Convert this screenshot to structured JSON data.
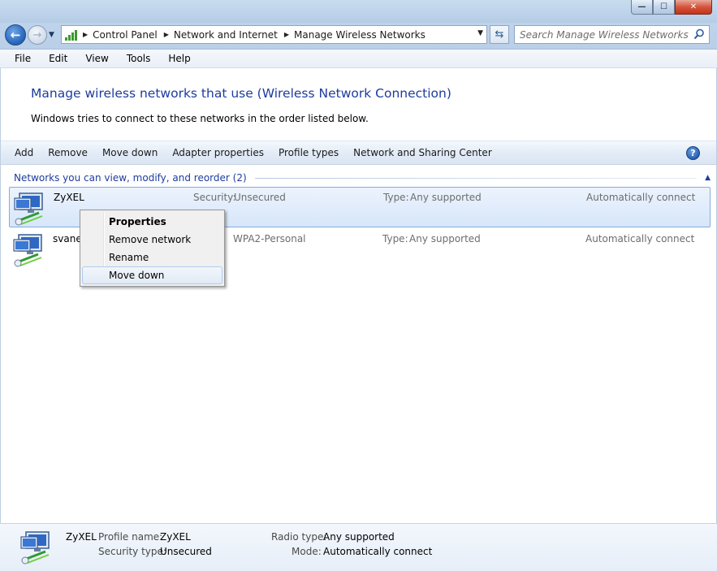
{
  "window": {
    "minimize_label": "—",
    "maximize_label": "☐",
    "close_label": "✕"
  },
  "address_bar": {
    "breadcrumbs": [
      "Control Panel",
      "Network and Internet",
      "Manage Wireless Networks"
    ],
    "search_placeholder": "Search Manage Wireless Networks"
  },
  "menu": [
    "File",
    "Edit",
    "View",
    "Tools",
    "Help"
  ],
  "page": {
    "title": "Manage wireless networks that use (Wireless Network Connection)",
    "description": "Windows tries to connect to these networks in the order listed below."
  },
  "commands": [
    "Add",
    "Remove",
    "Move down",
    "Adapter properties",
    "Profile types",
    "Network and Sharing Center"
  ],
  "help_label": "?",
  "group": {
    "title": "Networks you can view, modify, and reorder (2)"
  },
  "networks": [
    {
      "name": "ZyXEL",
      "security_label": "Security:",
      "security": "Unsecured",
      "type_label": "Type:",
      "type": "Any supported",
      "mode": "Automatically connect",
      "selected": true
    },
    {
      "name": "svaner",
      "security_label": "",
      "security": "WPA2-Personal",
      "type_label": "Type:",
      "type": "Any supported",
      "mode": "Automatically connect",
      "selected": false
    }
  ],
  "context_menu": [
    "Properties",
    "Remove network",
    "Rename",
    "Move down"
  ],
  "details": {
    "name": "ZyXEL",
    "profile_name_label": "Profile name:",
    "profile_name": "ZyXEL",
    "security_type_label": "Security type:",
    "security_type": "Unsecured",
    "radio_type_label": "Radio type:",
    "radio_type": "Any supported",
    "mode_label": "Mode:",
    "mode": "Automatically connect"
  },
  "colors": {
    "link_blue": "#1e3c9e",
    "selection_border": "#84acdd"
  }
}
